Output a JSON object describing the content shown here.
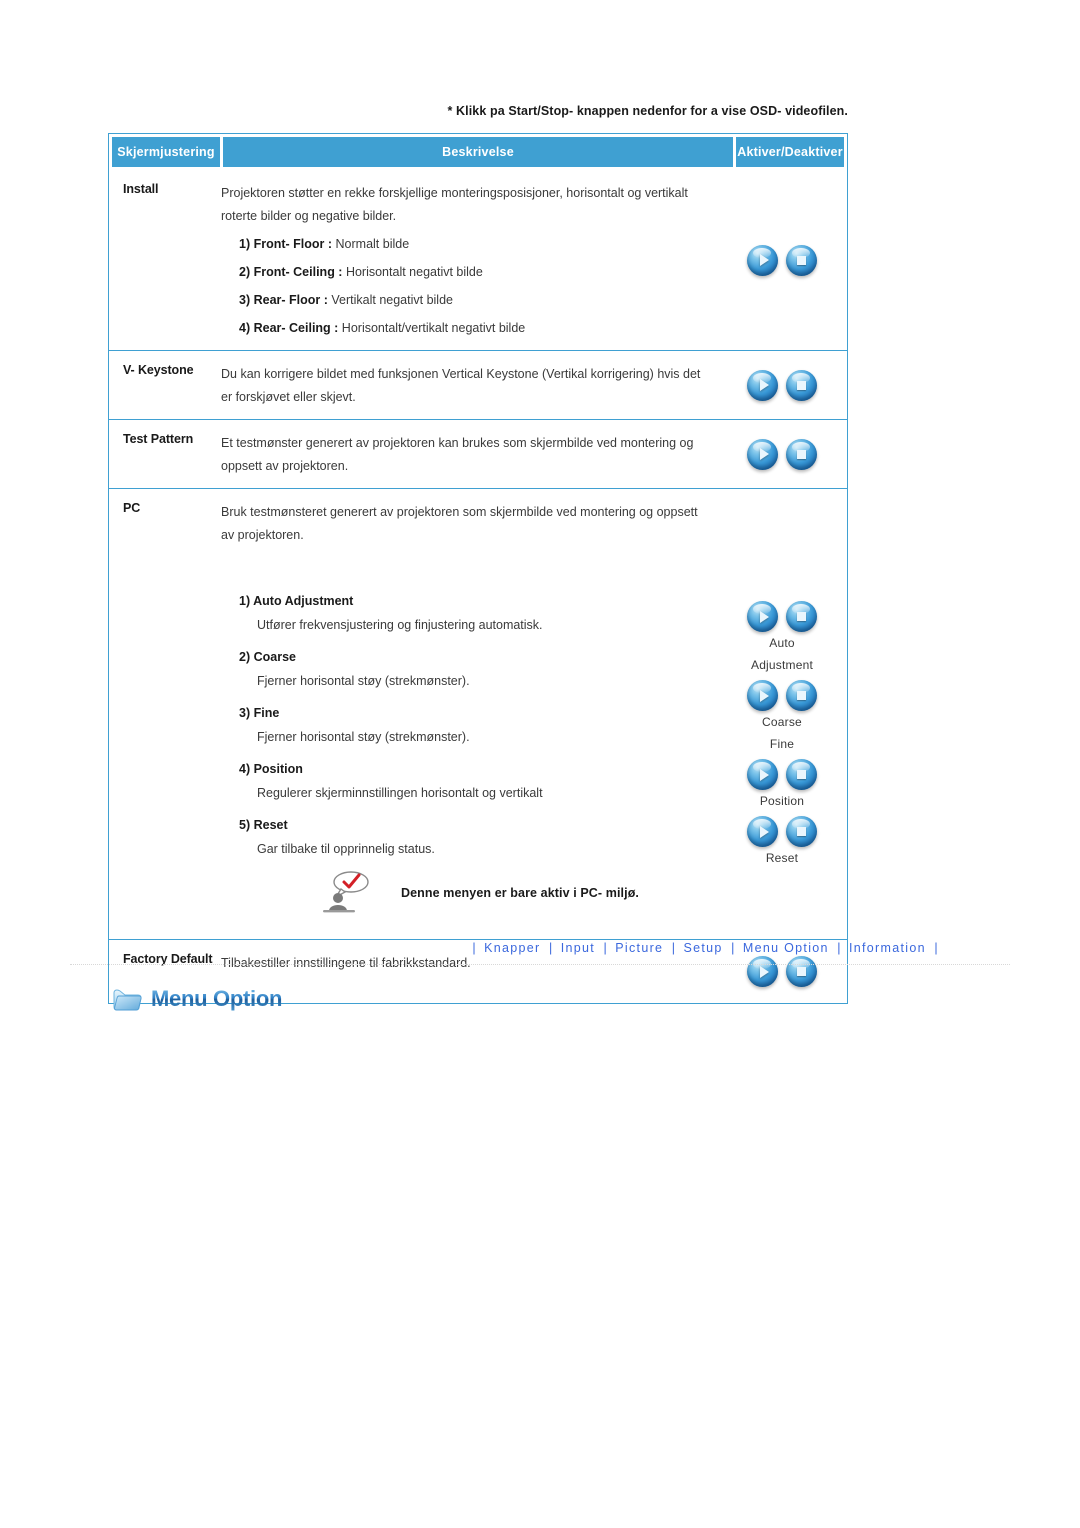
{
  "top_note": "* Klikk pa Start/Stop- knappen nedenfor for a vise OSD- videofilen.",
  "table": {
    "headers": {
      "col1": "Skjermjustering",
      "col2": "Beskrivelse",
      "col3": "Aktiver/Deaktiver"
    },
    "rows": [
      {
        "name": "Install",
        "desc_line1": "Projektoren støtter en rekke forskjellige monteringsposisjoner, horisontalt og vertikalt",
        "desc_line2": "roterte bilder og negative bilder.",
        "items": [
          {
            "label": "1) Front- Floor :",
            "text": " Normalt bilde"
          },
          {
            "label": "2) Front- Ceiling :",
            "text": " Horisontalt negativt bilde"
          },
          {
            "label": "3) Rear- Floor :",
            "text": " Vertikalt negativt bilde"
          },
          {
            "label": "4) Rear- Ceiling :",
            "text": " Horisontalt/vertikalt negativt bilde"
          }
        ]
      },
      {
        "name": "V- Keystone",
        "desc_line1": "Du kan korrigere bildet med funksjonen Vertical Keystone (Vertikal korrigering) hvis det",
        "desc_line2": "er forskjøvet eller skjevt."
      },
      {
        "name": "Test Pattern",
        "desc_line1": "Et testmønster generert av projektoren kan brukes som skjermbilde ved montering og",
        "desc_line2": "oppsett av projektoren."
      },
      {
        "name": "PC",
        "desc_line1": "Bruk testmønsteret generert av projektoren som skjermbilde ved montering og oppsett",
        "desc_line2": "av projektoren.",
        "subsections": [
          {
            "head": "1) Auto Adjustment",
            "body": "Utfører frekvensjustering og finjustering automatisk."
          },
          {
            "head": "2) Coarse",
            "body": "Fjerner horisontal støy (strekmønster)."
          },
          {
            "head": "3) Fine",
            "body": "Fjerner horisontal støy (strekmønster)."
          },
          {
            "head": "4) Position",
            "body": "Regulerer skjerminnstillingen horisontalt og vertikalt"
          },
          {
            "head": "5) Reset",
            "body": "Gar tilbake til opprinnelig status."
          }
        ],
        "button_labels": [
          "Auto",
          "Adjustment",
          "Coarse",
          "Fine",
          "Position",
          "Reset"
        ],
        "note": "Denne menyen er bare aktiv i PC- miljø."
      },
      {
        "name": "Factory Default",
        "desc_line1": "Tilbakestiller innstillingene til fabrikkstandard."
      }
    ]
  },
  "buttons": {
    "play_icon": "play-icon",
    "stop_icon": "stop-icon"
  },
  "bottom_nav": {
    "separator": "|",
    "links": [
      "Knapper",
      "Input",
      "Picture",
      "Setup",
      "Menu Option",
      "Information"
    ]
  },
  "section": {
    "icon": "folder-icon",
    "title": "Menu Option"
  },
  "colors": {
    "header_blue": "#3fa0d2",
    "nav_blue": "#3b68dd",
    "body_text": "#3a3a3a"
  }
}
